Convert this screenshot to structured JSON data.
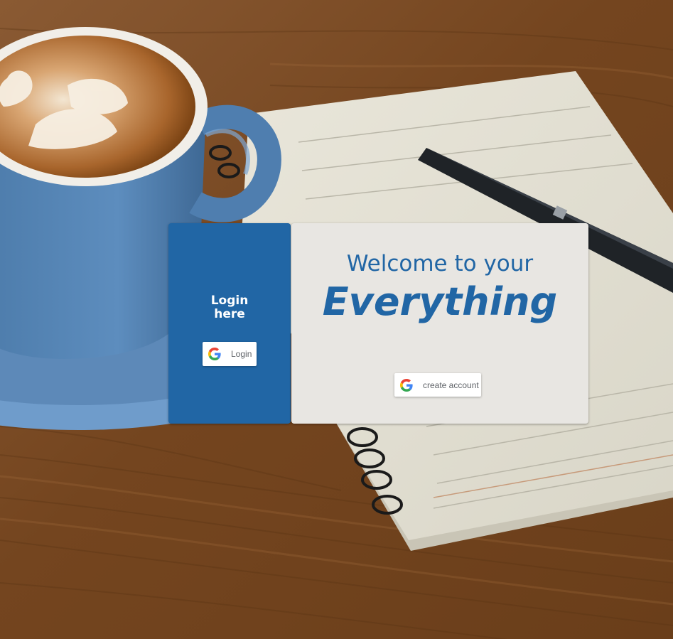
{
  "login_panel": {
    "title": "Login\nhere",
    "login_button_label": "Login",
    "login_button_icon": "google-icon",
    "background_color": "#2166a5"
  },
  "welcome_panel": {
    "welcome_line": "Welcome to your",
    "headline": "Everything",
    "create_button_label": "create account",
    "create_button_icon": "google-icon",
    "text_color": "#2166a5",
    "background_color": "#e8e6e2"
  },
  "background": {
    "description_icon": "coffee-and-notebook-background"
  }
}
